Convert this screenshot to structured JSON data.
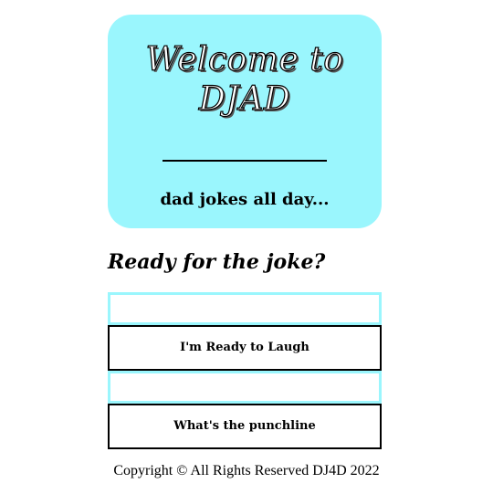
{
  "hero": {
    "title_line1": "Welcome to",
    "title_line2": "DJAD",
    "tagline": "dad jokes all day..."
  },
  "joke": {
    "heading": "Ready for the joke?",
    "setup_text": "",
    "punchline_text": "",
    "ready_button_label": "I'm Ready to Laugh",
    "punchline_button_label": "What's the punchline"
  },
  "footer": {
    "copyright": "Copyright © All Rights Reserved DJ4D 2022"
  },
  "colors": {
    "accent": "#9af6fd",
    "border": "#000000",
    "background": "#ffffff"
  }
}
